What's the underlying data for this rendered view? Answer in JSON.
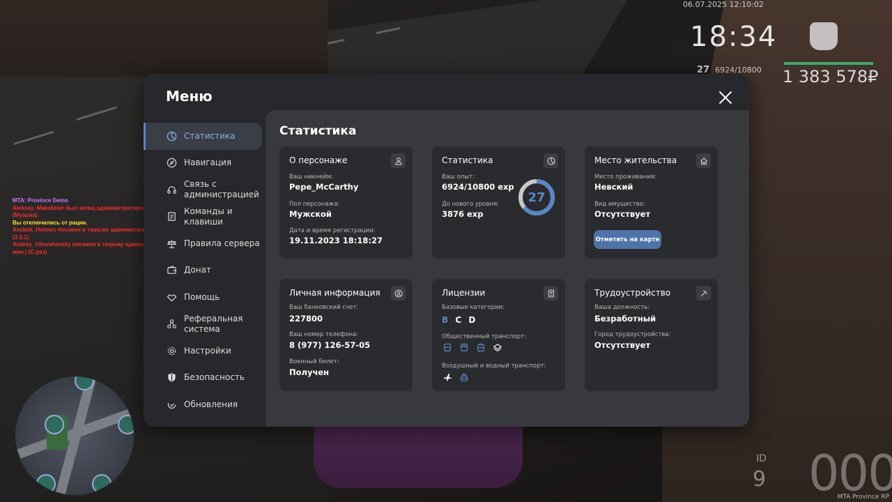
{
  "hud": {
    "date": "06.07.2025 12:10:02",
    "time": "18:34",
    "level": "27",
    "exp": "6924/10800",
    "money": "1 383 578₽",
    "speed": "000",
    "fuel": "9",
    "id": "ID",
    "corner": "MTA Province RP"
  },
  "chat": [
    {
      "text": "MTA: Province Demo",
      "color": "purple"
    },
    {
      "text": "Aleksey_Makalister был затащ администратором Matthew_Esposito (2 час.) (Музыка)",
      "color": "red"
    },
    {
      "text": "Вы отключились от рации.",
      "color": "yellow"
    },
    {
      "text": "Asubek_Holmes посажен в тюрьму администратором Matthew_Esposito (30 мин.) (3.3.1).",
      "color": "red"
    },
    {
      "text": "Andrey_Vdovshensky посажен в тюрьму администратором Matthew_Esposito (30 мин.) (С.рез)",
      "color": "red"
    }
  ],
  "modal": {
    "title": "Меню",
    "nav": [
      {
        "label": "Статистика",
        "icon": "chart-pie-icon",
        "active": true
      },
      {
        "label": "Навигация",
        "icon": "compass-icon",
        "active": false
      },
      {
        "label": "Связь с администрацией",
        "icon": "headset-icon",
        "active": false
      },
      {
        "label": "Команды и клавиши",
        "icon": "document-icon",
        "active": false
      },
      {
        "label": "Правила сервера",
        "icon": "scales-icon",
        "active": false
      },
      {
        "label": "Донат",
        "icon": "wallet-icon",
        "active": false
      },
      {
        "label": "Помощь",
        "icon": "handshake-icon",
        "active": false
      },
      {
        "label": "Реферальная система",
        "icon": "referral-icon",
        "active": false
      },
      {
        "label": "Настройки",
        "icon": "gear-icon",
        "active": false
      },
      {
        "label": "Безопасность",
        "icon": "shield-icon",
        "active": false
      },
      {
        "label": "Обновления",
        "icon": "refresh-check-icon",
        "active": false
      }
    ],
    "section_title": "Статистика",
    "cards": {
      "character": {
        "title": "О персонаже",
        "icon": "user-icon",
        "nickname_label": "Ваш никнейм:",
        "nickname": "Pepe_McCarthy",
        "gender_label": "Пол персонажа:",
        "gender": "Мужской",
        "reg_label": "Дата и время регистрации:",
        "reg": "19.11.2023 18:18:27"
      },
      "stats": {
        "title": "Статистика",
        "icon": "chart-pie-icon",
        "exp_label": "Ваш опыт:",
        "exp": "6924/10800 exp",
        "next_label": "До нового уровня:",
        "next": "3876 exp",
        "level": "27",
        "progress": 0.641
      },
      "residence": {
        "title": "Место жительства",
        "icon": "home-icon",
        "place_label": "Место проживания:",
        "place": "Невский",
        "property_label": "Вид имущества:",
        "property": "Отсутствует",
        "map_button": "Отметить на карте"
      },
      "personal": {
        "title": "Личная информация",
        "icon": "id-circle-icon",
        "bank_label": "Ваш банковский счет:",
        "bank": "227800",
        "phone_label": "Ваш номер телефона:",
        "phone": "8 (977) 126-57-05",
        "military_label": "Военный билет:",
        "military": "Получен"
      },
      "licenses": {
        "title": "Лицензии",
        "icon": "license-icon",
        "base_label": "Базовые категории:",
        "categories": [
          {
            "name": "B",
            "owned": true
          },
          {
            "name": "C",
            "owned": false
          },
          {
            "name": "D",
            "owned": false
          }
        ],
        "public_label": "Общественный транспорт:",
        "public_icons": [
          "bus-icon",
          "bus-icon",
          "tram-icon",
          "taxi-icon"
        ],
        "air_label": "Воздушный и водный транспорт:",
        "air_icons": [
          "plane-icon",
          "boat-icon"
        ]
      },
      "job": {
        "title": "Трудоустройство",
        "icon": "pickaxe-icon",
        "position_label": "Ваша должность:",
        "position": "Безработный",
        "city_label": "Город трудоустройства:",
        "city": "Отсутствует"
      }
    }
  }
}
